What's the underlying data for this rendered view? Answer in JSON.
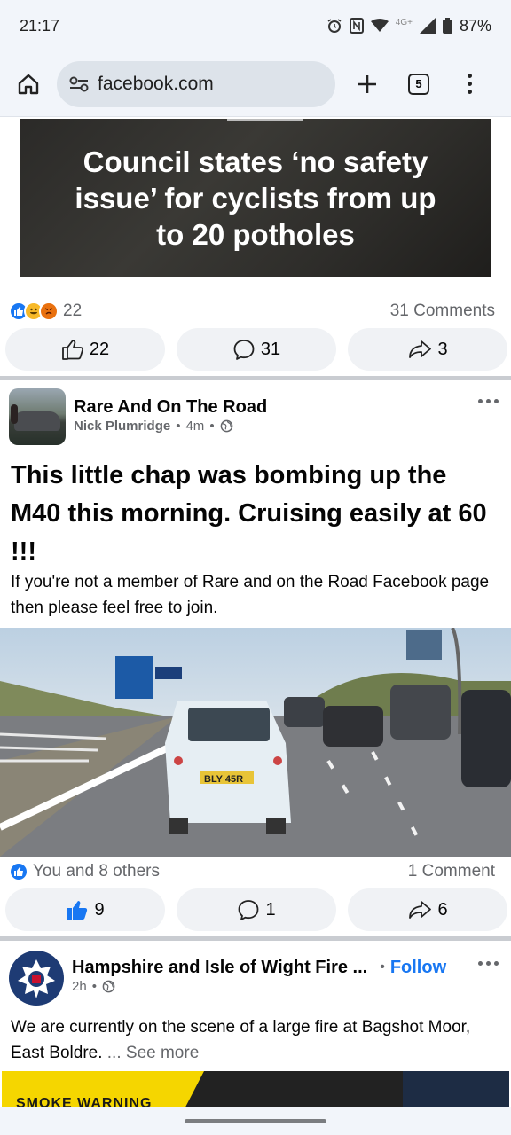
{
  "status_bar": {
    "time": "21:17",
    "battery": "87%",
    "network": "4G+"
  },
  "browser": {
    "url": "facebook.com",
    "tab_count": "5"
  },
  "post1": {
    "headline": "Council states ‘no safety issue’ for cyclists from up to 20 potholes",
    "reactions_count": "22",
    "comments_count": "31 Comments",
    "like_count": "22",
    "comment_count": "31",
    "share_count": "3"
  },
  "post2": {
    "page_name": "Rare And On The Road",
    "author": "Nick Plumridge",
    "time": "4m",
    "title": "This little chap was bombing up the M40 this morning. Cruising easily at 60 !!!",
    "body": "If you're not a member of Rare and on the Road Facebook page then please feel free to join.",
    "plate": "BLY 45R",
    "reactions_text": "You and 8 others",
    "comments_count": "1 Comment",
    "like_count": "9",
    "comment_count": "1",
    "share_count": "6"
  },
  "post3": {
    "page_name": "Hampshire and Isle of Wight Fire ...",
    "follow_label": "Follow",
    "time": "2h",
    "body": "We are currently on the scene of a large fire at Bagshot Moor, East Boldre.",
    "see_more": "... See more",
    "banner_text": "SMOKE WARNING"
  },
  "colors": {
    "accent": "#1877f2",
    "muted": "#65676b",
    "button_bg": "#f0f2f5"
  }
}
